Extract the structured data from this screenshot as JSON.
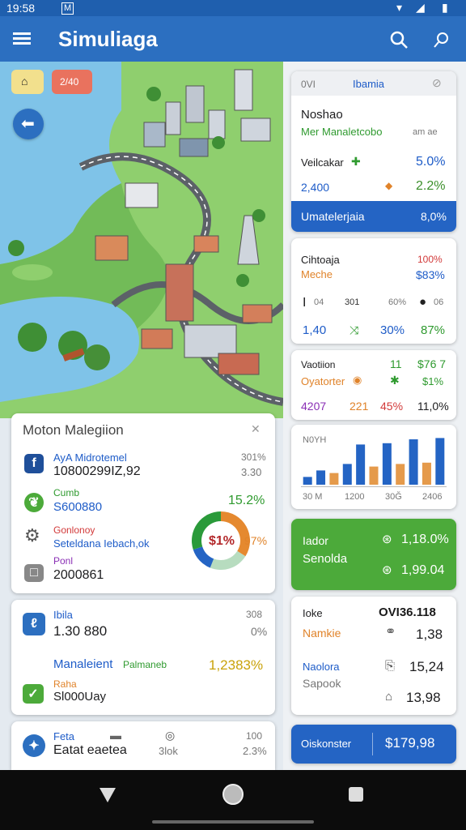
{
  "status": {
    "time": "19:58",
    "badge": "M"
  },
  "appbar": {
    "title": "Simuliaga"
  },
  "colors": {
    "primary": "#2c6fc0",
    "accent_green": "#4caa3a",
    "text_green": "#2f9a2f",
    "text_blue": "#1e5cc8",
    "text_orange": "#e0832a",
    "text_red": "#d23a3a"
  },
  "map": {
    "chip_left": "",
    "chip_right": "2/40"
  },
  "card_a": {
    "tab_left": "0VI",
    "tab_right": "Ibamia",
    "title": "Noshao",
    "subtitle": "Mer Manaletcobo",
    "sub_right": "am ae",
    "r1_label": "Veilcakar",
    "r1_val": "5.0%",
    "r2_label": "2,400",
    "r2_val": "2.2%",
    "highlight_label": "Umatelerjaia",
    "highlight_val": "8,0%"
  },
  "card_b": {
    "title": "Cihtoaja",
    "title_val": "100%",
    "sub": "Meche",
    "sub_val": "$83%",
    "m1": "I",
    "m1b": "04",
    "m2": "301",
    "m3": "60%",
    "m4": "06",
    "v1": "1,40",
    "v2": "30%",
    "v3": "87%"
  },
  "card_c": {
    "r1_label": "Vaotiion",
    "r1_a": "11",
    "r1_b": "$76 7",
    "r2_label": "Oyatorter",
    "r2_b": "$1%",
    "r3_a": "4207",
    "r3_b": "221",
    "r3_c": "45%",
    "r3_d": "11,0%"
  },
  "card_d": {
    "title": "N0YH",
    "ticks": [
      "30 M",
      "1200",
      "30Ğ",
      "2406"
    ]
  },
  "chart_data": {
    "type": "bar",
    "title": "N0YH",
    "categories": [
      "30 M",
      "",
      "1200",
      "",
      "30Ğ",
      "",
      "2406",
      ""
    ],
    "series": [
      {
        "values": [
          12,
          22,
          18,
          32,
          62,
          28,
          64,
          32,
          70,
          34,
          72
        ]
      }
    ],
    "ylim": [
      0,
      80
    ]
  },
  "card_e": {
    "label1": "Iador",
    "val1": "1,18.0%",
    "label2": "Senolda",
    "val2": "1,99.04"
  },
  "card_f": {
    "r1_label": "Ioke",
    "r1_val": "OVI36.118",
    "r2_label": "Namkie",
    "r2_val": "1,38",
    "r3_label": "Naolora",
    "r3_val": "15,24",
    "r4_label": "Sapook",
    "r4_val": "13,98"
  },
  "card_g": {
    "label": "Oiskonster",
    "val": "$179,98"
  },
  "panel": {
    "title": "Moton Malegiion",
    "r1_label": "AyA Midrotemel",
    "r1_val": "10800299IZ,92",
    "r1_right": "301%",
    "r1_right2": "3.30",
    "r2_label": "Cumb",
    "r2_val": "S600880",
    "r2_right": "15.2%",
    "r3_label": "Gonlonoy",
    "r3_val": "Seteldana Iebach,ok",
    "r4_label": "Ponl",
    "r4_val": "2000861",
    "donut_left": "$1%",
    "donut_right": "97%",
    "donut_values": [
      34,
      22,
      14,
      30
    ]
  },
  "card_h": {
    "r1_label": "Ibila",
    "r1_val": "1.30 880",
    "r1_right": "308",
    "r1_right2": "0%",
    "r2_label": "Manaleient",
    "r2_label2": "Palmaneb",
    "r2_right": "1,2383%",
    "r3_label": "Raha",
    "r3_val": "Sl000Uay"
  },
  "card_i": {
    "r1_label": "Feta",
    "r1_val": "Eatat eaetea",
    "r1_mid": "3lok",
    "r1_right": "100",
    "r1_right2": "2.3%"
  }
}
